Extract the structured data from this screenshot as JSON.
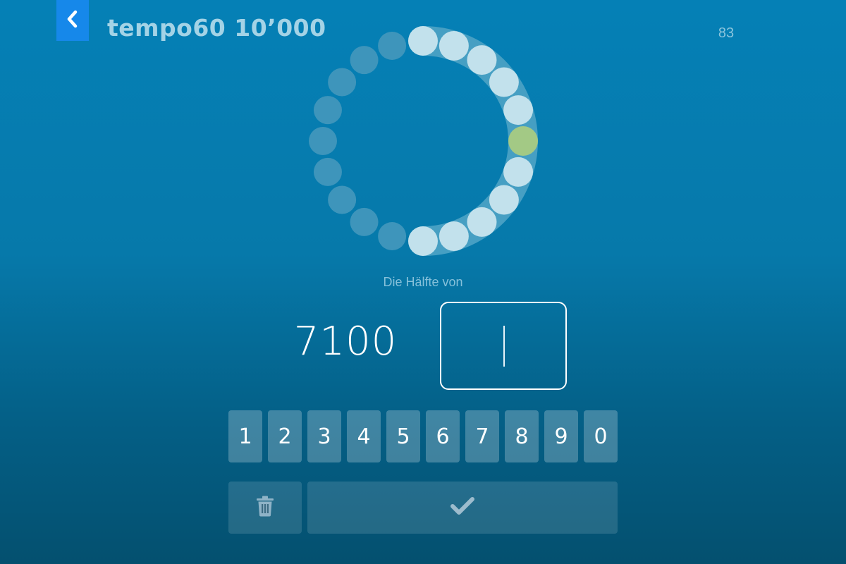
{
  "header": {
    "title": "tempo60 10’000",
    "score": "83",
    "back_icon": "chevron-left-icon"
  },
  "progress": {
    "total_steps": 20,
    "done_steps": 11,
    "current_step": 6,
    "done_color": "#c2e1ec",
    "pending_color": "#3e95bb",
    "current_color": "#a3c985",
    "track_color": "#469fc3"
  },
  "task": {
    "prompt": "Die Hälfte von",
    "number": "7100",
    "answer": ""
  },
  "keypad": {
    "keys": [
      "1",
      "2",
      "3",
      "4",
      "5",
      "6",
      "7",
      "8",
      "9",
      "0"
    ],
    "delete_icon": "trash-icon",
    "confirm_icon": "checkmark-icon"
  }
}
